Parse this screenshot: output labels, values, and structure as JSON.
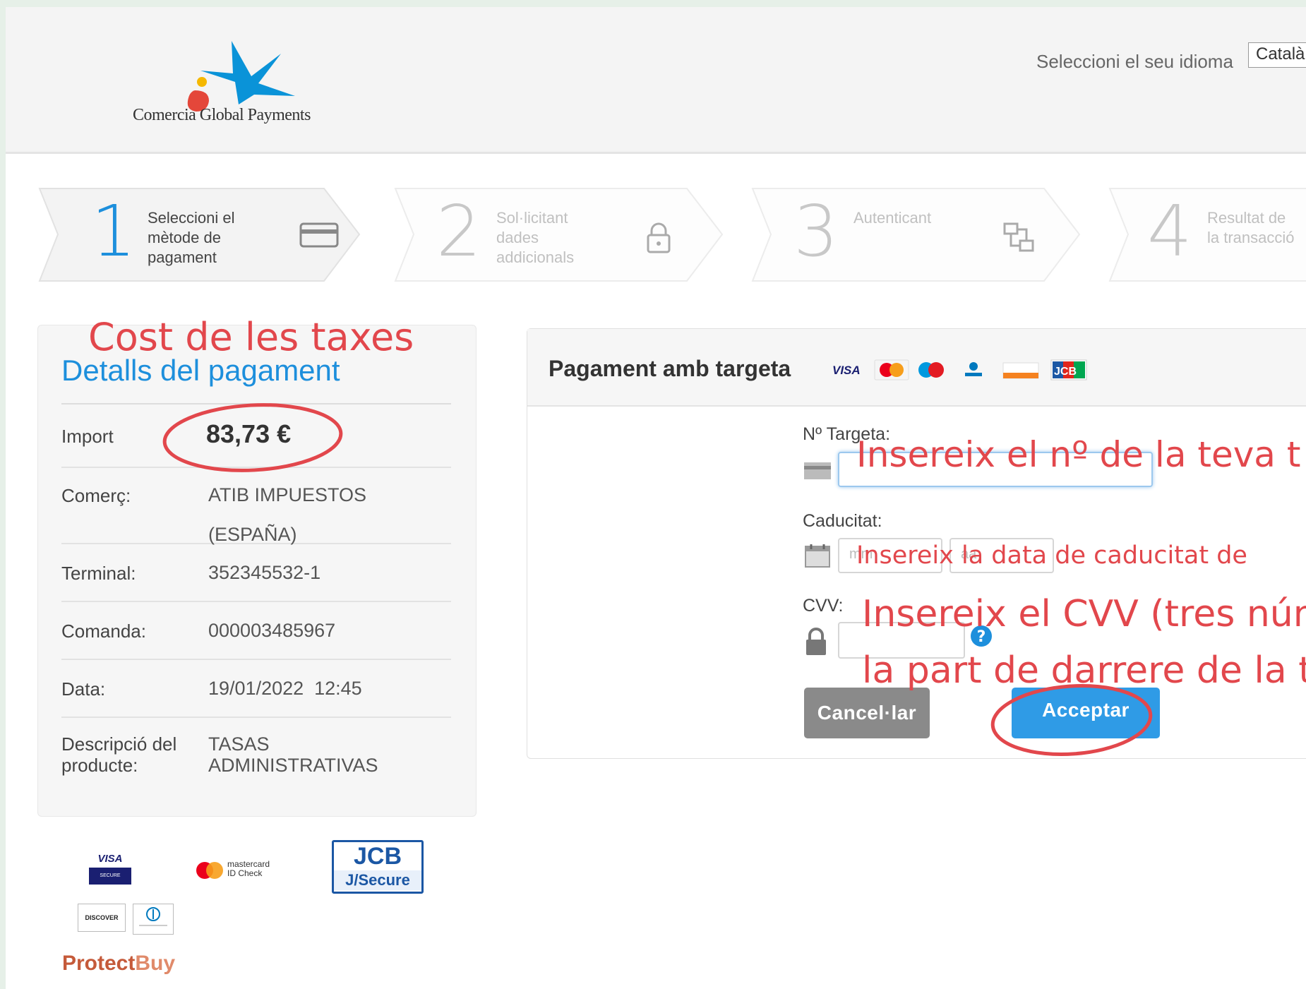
{
  "header": {
    "logo_text": "Comercia Global Payments",
    "language_label": "Seleccioni el seu idioma",
    "language_value": "Català"
  },
  "steps": [
    {
      "number": "1",
      "label_l1": "Seleccioni el",
      "label_l2": "mètode de",
      "label_l3": "pagament",
      "icon": "credit-card-icon",
      "active": true
    },
    {
      "number": "2",
      "label_l1": "Sol·licitant",
      "label_l2": "dades",
      "label_l3": "addicionals",
      "icon": "lock-icon",
      "active": false
    },
    {
      "number": "3",
      "label_l1": "Autenticant",
      "label_l2": "",
      "label_l3": "",
      "icon": "network-icon",
      "active": false
    },
    {
      "number": "4",
      "label_l1": "Resultat de",
      "label_l2": "la transacció",
      "label_l3": "",
      "icon": "",
      "active": false
    }
  ],
  "details": {
    "title": "Detalls del pagament",
    "rows": [
      {
        "label": "Import",
        "value": "83,73 €"
      },
      {
        "label": "Comerç:",
        "value_l1": "ATIB IMPUESTOS",
        "value_l2": "(ESPAÑA)"
      },
      {
        "label": "Terminal:",
        "value": "352345532-1"
      },
      {
        "label": "Comanda:",
        "value": "000003485967"
      },
      {
        "label": "Data:",
        "value": "19/01/2022  12:45"
      },
      {
        "label_l1": "Descripció del",
        "label_l2": "producte:",
        "value_l1": "TASAS",
        "value_l2": "ADMINISTRATIVAS"
      }
    ]
  },
  "brands": {
    "visa": "VISA",
    "visa_sub": "SECURE",
    "mastercard_l1": "mastercard",
    "mastercard_l2": "ID Check",
    "jcb_l1": "JCB",
    "jcb_l2": "J/Secure",
    "discover": "DISCOVER",
    "protect_a": "Protect",
    "protect_b": "Buy"
  },
  "payment": {
    "title": "Pagament amb targeta",
    "card_label": "Nº Targeta:",
    "expiry_label": "Caducitat:",
    "expiry_month_placeholder": "mm",
    "expiry_year_placeholder": "aa",
    "cvv_label": "CVV:",
    "cancel_label": "Cancel·lar",
    "accept_label": "Acceptar",
    "mini_logos": [
      "VISA",
      "mastercard",
      "maestro",
      "diners",
      "DISCOVER",
      "JCB"
    ]
  },
  "annotations": {
    "taxes": "Cost de les taxes",
    "card_number": "Insereix el nº de la teva t",
    "expiry": "Insereix la data de caducitat de",
    "cvv_l1": "Insereix el CVV (tres núm",
    "cvv_l2": "la part de darrere de la t"
  },
  "colors": {
    "accent_blue": "#1d8fdc",
    "annotation_red": "#e2474c",
    "accept_button": "#2f9be6",
    "cancel_button": "#8a8a8a"
  }
}
